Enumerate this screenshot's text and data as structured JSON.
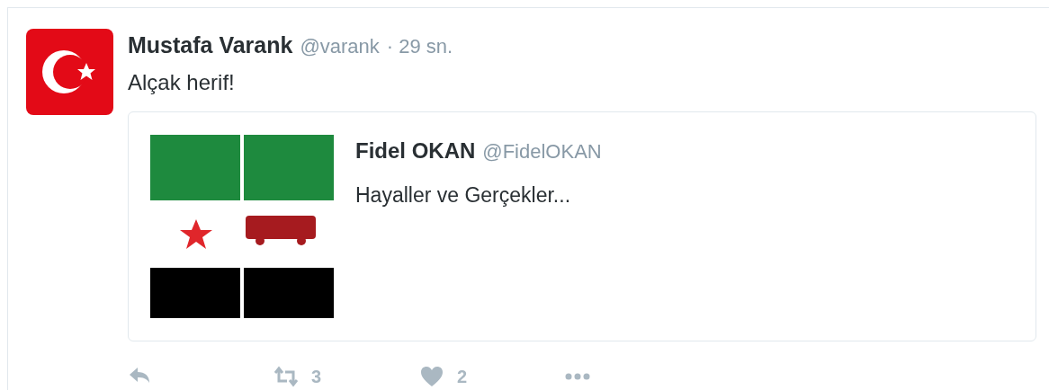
{
  "tweet": {
    "author": "Mustafa Varank",
    "handle": "@varank",
    "time": "· 29 sn.",
    "text": "Alçak herif!",
    "quote": {
      "author": "Fidel OKAN",
      "handle": "@FidelOKAN",
      "text": "Hayaller ve Gerçekler..."
    },
    "actions": [
      {
        "kind": "reply"
      },
      {
        "kind": "retweet",
        "count": "3"
      },
      {
        "kind": "like",
        "count": "2"
      },
      {
        "kind": "more"
      }
    ]
  }
}
